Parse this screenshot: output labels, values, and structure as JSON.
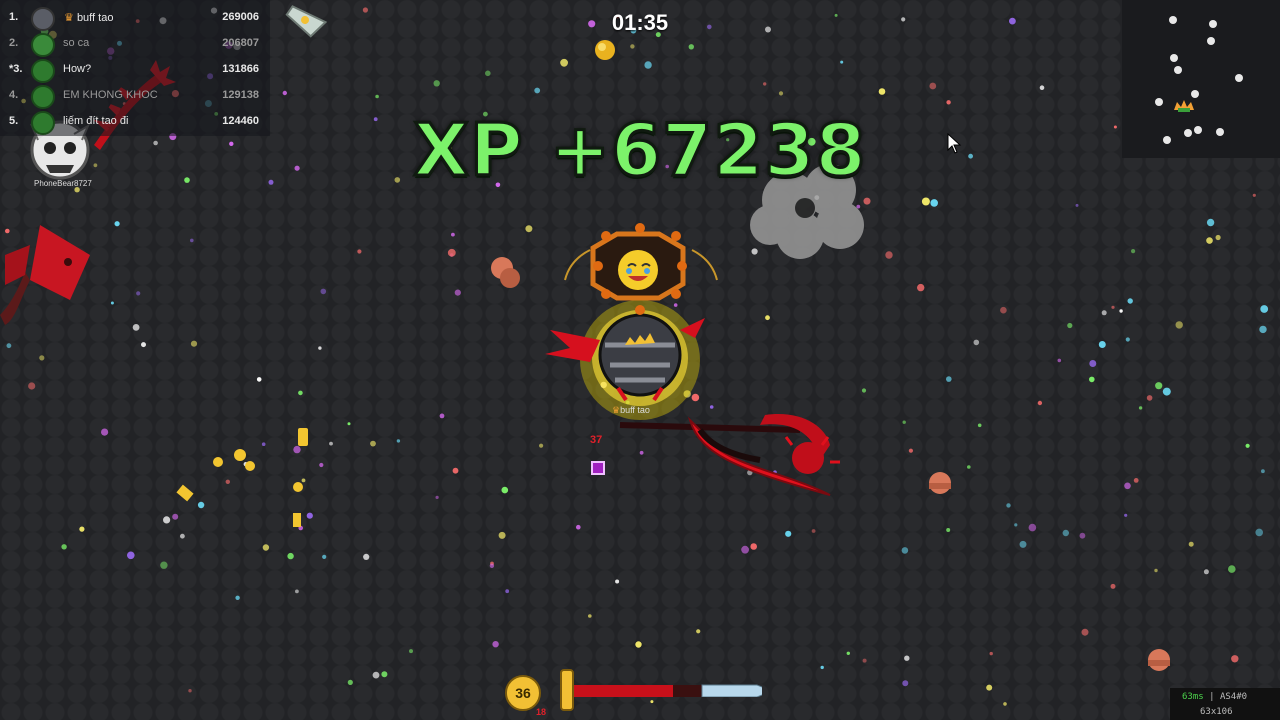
{
  "leaderboard": [
    {
      "rank": "1.",
      "name": "buff tao",
      "score": "269006",
      "crown": true,
      "dim": false
    },
    {
      "rank": "2.",
      "name": "so ca",
      "score": "206807",
      "crown": false,
      "dim": true
    },
    {
      "rank": "*3.",
      "name": "How?",
      "score": "131866",
      "crown": false,
      "dim": false
    },
    {
      "rank": "4.",
      "name": "EM KHONG KHOC",
      "score": "129138",
      "crown": false,
      "dim": true
    },
    {
      "rank": "5.",
      "name": "liếm đít tao đi",
      "score": "124460",
      "crown": false,
      "dim": false
    }
  ],
  "timer": "01:35",
  "xp_popup": "XP +67238",
  "player": {
    "name": "buff tao",
    "hp_number": "37"
  },
  "other_player": {
    "name": "PhoneBear8727"
  },
  "level": {
    "value": "36",
    "sub": "18",
    "progress": 0.78
  },
  "netinfo": {
    "ping": "63ms",
    "sep": " | AS4#0",
    "size": "63x106"
  },
  "colors": {
    "xp_green": "#7cf26a",
    "gold": "#f2c034",
    "blood_red": "#d6101e",
    "background": "#222326"
  }
}
